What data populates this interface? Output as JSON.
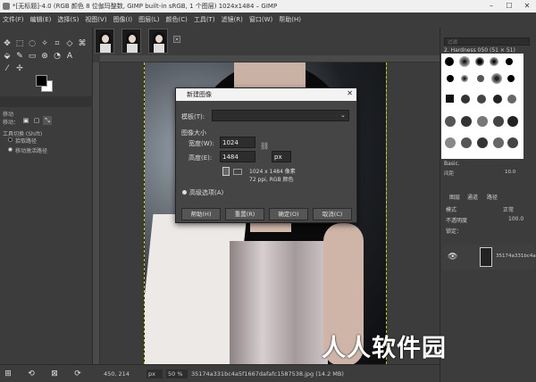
{
  "window": {
    "title": "*[无标题]-4.0 (RGB 颜色 8 位伽玛整数, GIMP built-in sRGB, 1 个图层) 1024x1484 – GIMP",
    "minimize": "–",
    "maximize": "☐",
    "close": "✕"
  },
  "menubar": [
    "文件(F)",
    "编辑(E)",
    "选择(S)",
    "视图(V)",
    "图像(I)",
    "图层(L)",
    "颜色(C)",
    "工具(T)",
    "滤镜(R)",
    "窗口(W)",
    "帮助(H)"
  ],
  "tool_options": {
    "section": "移动",
    "mode_label": "移动：",
    "switch_label": "工具切换 (Shift)",
    "option1": "拾取路径",
    "option2": "移动激活路径"
  },
  "dialog": {
    "title": "新建图像",
    "template_label": "模板(T):",
    "template_value": "",
    "size_header": "图像大小",
    "width_label": "宽度(W):",
    "width_value": "1024",
    "height_label": "高度(E):",
    "height_value": "1484",
    "unit": "px",
    "info_line1": "1024 x 1484 像素",
    "info_line2": "72 ppi, RGB 颜色",
    "advanced": "高级选项(A)",
    "btn_help": "帮助(H)",
    "btn_reset": "重置(R)",
    "btn_ok": "确定(O)",
    "btn_cancel": "取消(C)"
  },
  "status": {
    "coords": "450, 214",
    "unit": "px",
    "zoom": "50 %",
    "info": "35174a331bc4a5f1667dafafc1587538.jpg (14.2 MB)"
  },
  "right_panel": {
    "filter_placeholder": "过滤",
    "brush_name": "2. Hardness 050 (51 × 51)",
    "preset_label": "Basic.",
    "spacing_label": "间距",
    "spacing_value": "10.0",
    "tabs": [
      "图层",
      "通道",
      "路径"
    ],
    "mode_label": "模式",
    "mode_value": "正常",
    "opacity_label": "不透明度",
    "opacity_value": "100.0",
    "lock_label": "锁定：",
    "layer_name": "35174a331bc4a"
  },
  "watermark": "人人软件园"
}
